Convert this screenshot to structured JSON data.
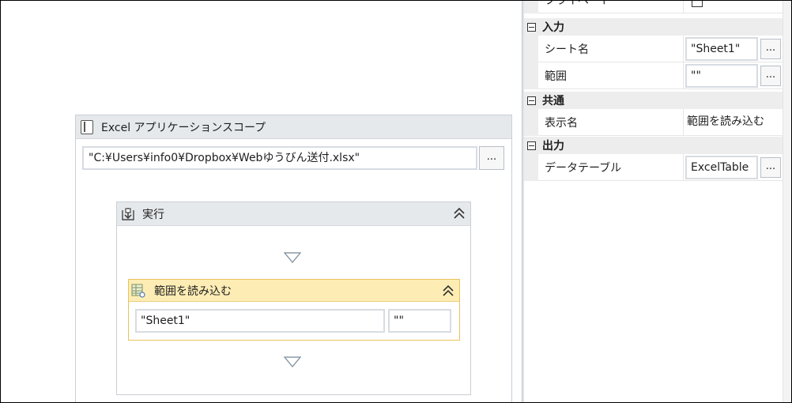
{
  "designer": {
    "scope": {
      "title": "Excel アプリケーションスコープ",
      "workbook_path": "\"C:¥Users¥info0¥Dropbox¥Webゆうびん送付.xlsx\"",
      "ellipsis_label": "..."
    },
    "sequence": {
      "title": "実行"
    },
    "activity": {
      "title": "範囲を読み込む",
      "sheet_value": "\"Sheet1\"",
      "range_value": "\"\""
    }
  },
  "properties": {
    "private_label": "プライベート",
    "categories": {
      "input": "入力",
      "common": "共通",
      "output": "出力"
    },
    "rows": {
      "sheet_name": {
        "label": "シート名",
        "value": "\"Sheet1\""
      },
      "range": {
        "label": "範囲",
        "value": "\"\""
      },
      "display_name": {
        "label": "表示名",
        "value": "範囲を読み込む"
      },
      "data_table": {
        "label": "データテーブル",
        "value": "ExcelTable"
      }
    },
    "ellipsis_label": "..."
  },
  "colors": {
    "activity_header": "#fdedb4",
    "activity_border": "#e8c35c",
    "container_header": "#e6e9ec"
  }
}
